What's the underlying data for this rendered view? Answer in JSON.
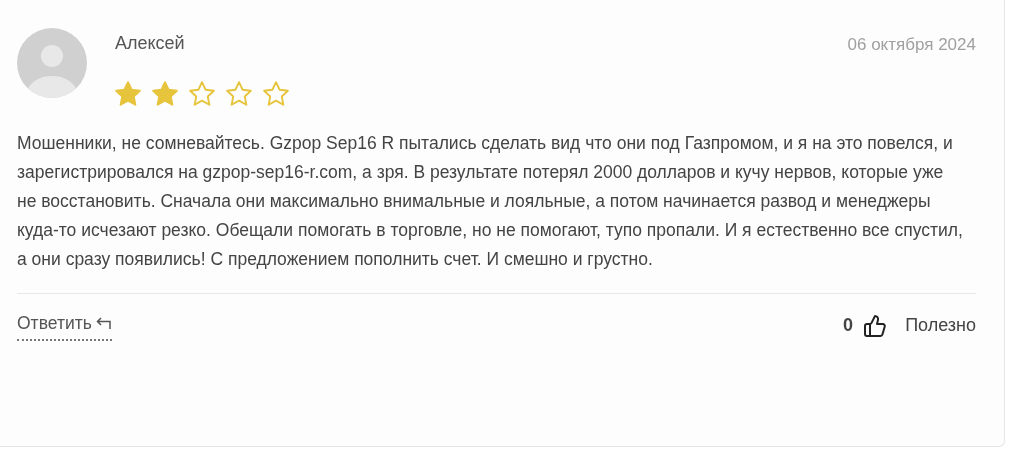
{
  "review": {
    "author": "Алексей",
    "date": "06 октября 2024",
    "stars": 2,
    "text": "Мошенники, не сомневайтесь. Gzpop Sep16 R пытались сделать вид что они под Газпромом, и я на это повелся, и зарегистрировался на gzpop-sep16-r.com, а зря. В результате потерял 2000 долларов и кучу нервов, которые уже не восстановить. Сначала они максимально внимальные и лояльные, а потом начинается развод и менеджеры куда-то исчезают резко. Обещали помогать в торговле, но не помогают, тупо пропали. И я естественно все спустил, а они сразу появились! С предложением пополнить счет. И смешно и грустно.",
    "reply": "Ответить",
    "likes": "0",
    "helpful": "Полезно"
  }
}
